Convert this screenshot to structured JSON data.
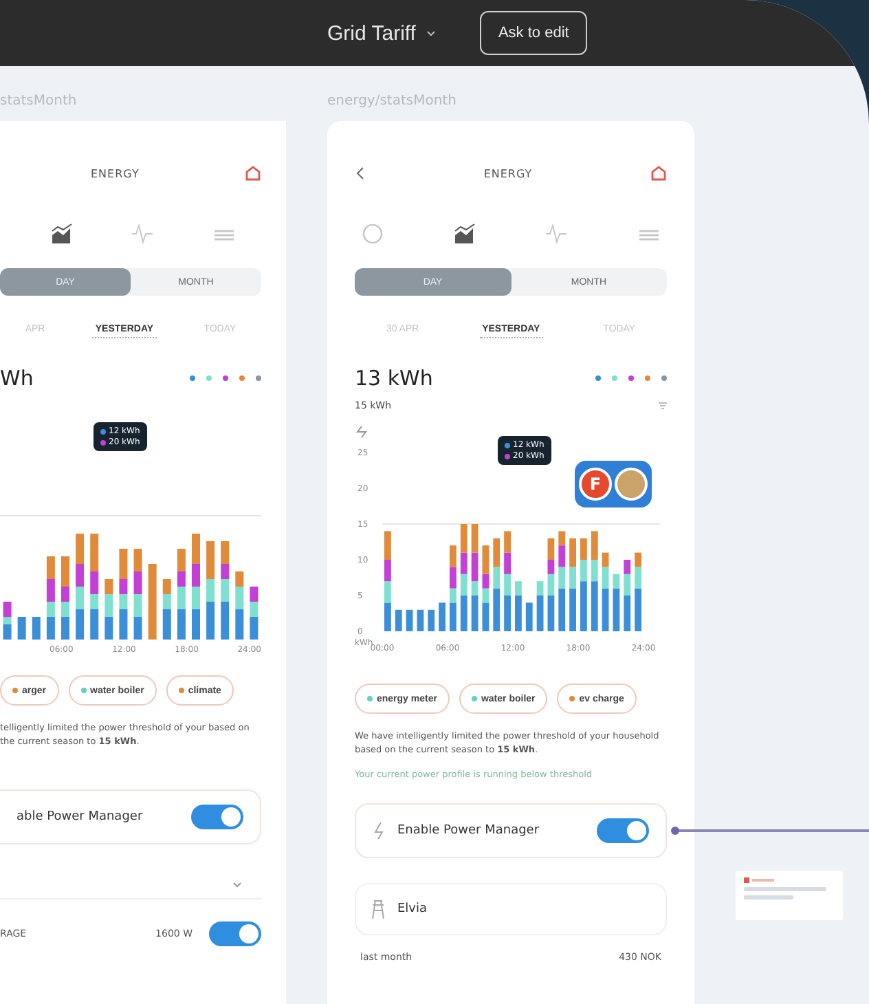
{
  "toolbar": {
    "title": "Grid Tariff",
    "button": "Ask to edit"
  },
  "left_frame": {
    "label": "statsMonth",
    "header": {
      "title": "ENERGY"
    },
    "view_icons": [
      {
        "kind": "chart",
        "selected": true
      },
      {
        "kind": "wave",
        "selected": false
      },
      {
        "kind": "bars",
        "selected": false
      }
    ],
    "segments": [
      {
        "label": "DAY",
        "selected": true
      },
      {
        "label": "MONTH",
        "selected": false
      }
    ],
    "dates": [
      {
        "label": "APR",
        "selected": false
      },
      {
        "label": "YESTERDAY",
        "selected": true
      },
      {
        "label": "TODAY",
        "selected": false
      }
    ],
    "total": "Wh",
    "legend": [
      {
        "color": "#3b8fd9"
      },
      {
        "color": "#7fe0d0"
      },
      {
        "color": "#c33fd6"
      },
      {
        "color": "#e08a3a"
      },
      {
        "color": "#8a96a8"
      }
    ],
    "tooltip": [
      "12 kWh",
      "20 kWh"
    ],
    "x_labels": [
      "06:00",
      "12:00",
      "18:00",
      "24:00"
    ],
    "chips": [
      {
        "label": "arger",
        "color": "#e08a3a"
      },
      {
        "label": "water boiler",
        "color": "#5fd3c0"
      },
      {
        "label": "climate",
        "color": "#e08a3a"
      }
    ],
    "message": "telligently limited the power threshold of your based on the current season to **15 kWh**.",
    "power_manager": {
      "label": "able Power Manager",
      "on": true
    },
    "row": {
      "label": "RAGE",
      "value": "1600 W",
      "on": true
    }
  },
  "right_frame": {
    "label": "energy/statsMonth",
    "header": {
      "title": "ENERGY"
    },
    "view_icons": [
      {
        "kind": "ring",
        "selected": false
      },
      {
        "kind": "chart",
        "selected": true
      },
      {
        "kind": "wave",
        "selected": false
      },
      {
        "kind": "bars",
        "selected": false
      }
    ],
    "segments": [
      {
        "label": "DAY",
        "selected": true
      },
      {
        "label": "MONTH",
        "selected": false
      }
    ],
    "dates": [
      {
        "label": "30 APR",
        "selected": false
      },
      {
        "label": "YESTERDAY",
        "selected": true
      },
      {
        "label": "TODAY",
        "selected": false
      }
    ],
    "total": "13 kWh",
    "subtotal": "15 kWh",
    "legend": [
      {
        "color": "#3b8fd9"
      },
      {
        "color": "#7fe0d0"
      },
      {
        "color": "#c33fd6"
      },
      {
        "color": "#e08a3a"
      },
      {
        "color": "#8a96a8"
      }
    ],
    "tooltip": [
      "12 kWh",
      "20 kWh"
    ],
    "chart_data": {
      "type": "bar",
      "stacked": true,
      "ylabel": "kWh",
      "x": [
        0.5,
        1.5,
        2.5,
        3.5,
        4.5,
        5.5,
        6.5,
        7.5,
        8.5,
        9.5,
        10.5,
        11.5,
        12.5,
        13.5,
        14.5,
        15.5,
        16.5,
        17.5,
        18.5,
        19.5,
        20.5,
        21.5,
        22.5,
        23.5
      ],
      "xlim": [
        0,
        24
      ],
      "xticks": [
        {
          "value": 0,
          "label": "00:00"
        },
        {
          "value": 6,
          "label": "06:00"
        },
        {
          "value": 12,
          "label": "12:00"
        },
        {
          "value": 18,
          "label": "18:00"
        },
        {
          "value": 24,
          "label": "24:00"
        }
      ],
      "yticks": [
        0,
        5,
        10,
        15,
        20,
        25
      ],
      "ylim": [
        0,
        25
      ],
      "series": [
        {
          "color": "#3b8fd9",
          "values": [
            4,
            3,
            3,
            3,
            3,
            4,
            4,
            5,
            5,
            4,
            6,
            5,
            5,
            4,
            5,
            5,
            6,
            6,
            7,
            7,
            6,
            6,
            5,
            6
          ]
        },
        {
          "color": "#7fe0d0",
          "values": [
            3,
            0,
            0,
            0,
            0,
            0,
            2,
            3,
            2,
            2,
            3,
            3,
            2,
            0,
            2,
            3,
            3,
            3,
            3,
            3,
            3,
            2,
            3,
            3
          ]
        },
        {
          "color": "#c33fd6",
          "values": [
            3,
            0,
            0,
            0,
            0,
            0,
            3,
            3,
            4,
            2,
            0,
            3,
            0,
            0,
            0,
            2,
            3,
            0,
            0,
            0,
            0,
            0,
            2,
            0
          ]
        },
        {
          "color": "#e08a3a",
          "values": [
            4,
            0,
            0,
            0,
            0,
            0,
            3,
            4,
            4,
            4,
            4,
            3,
            0,
            0,
            0,
            3,
            2,
            4,
            3,
            4,
            2,
            0,
            0,
            2
          ]
        }
      ]
    },
    "collaborators": [
      {
        "kind": "initial",
        "text": "F"
      },
      {
        "kind": "photo"
      }
    ],
    "chips": [
      {
        "label": "energy meter",
        "color": "#5fd3c0"
      },
      {
        "label": "water boiler",
        "color": "#5fd3c0"
      },
      {
        "label": "ev charge",
        "color": "#e08a3a"
      }
    ],
    "message": "We have intelligently limited the power threshold of your household based on the current season to **15 kWh**.",
    "status": "Your current power profile is running below threshold",
    "power_manager": {
      "label": "Enable Power Manager",
      "on": true
    },
    "provider": {
      "name": "Elvia"
    },
    "rows": [
      {
        "label": "last month",
        "value": "430 NOK"
      }
    ]
  }
}
